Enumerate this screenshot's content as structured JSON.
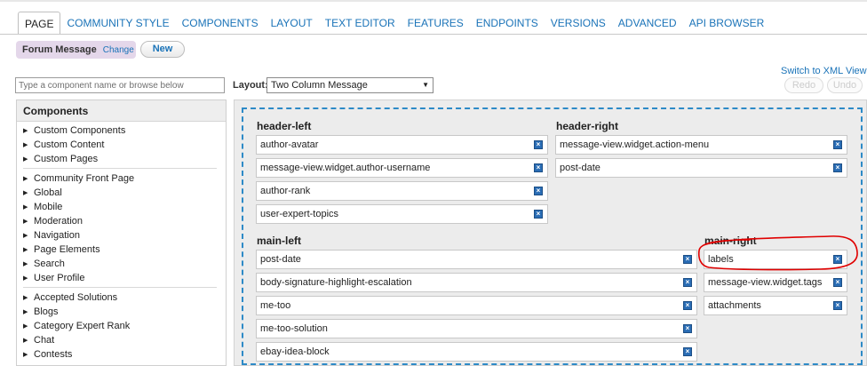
{
  "tabs": [
    "PAGE",
    "COMMUNITY STYLE",
    "COMPONENTS",
    "LAYOUT",
    "TEXT EDITOR",
    "FEATURES",
    "ENDPOINTS",
    "VERSIONS",
    "ADVANCED",
    "API BROWSER"
  ],
  "template": {
    "name": "Forum Message",
    "change_label": "Change"
  },
  "new_button": "New",
  "xml_link": "Switch to XML View",
  "search": {
    "placeholder": "Type a component name or browse below",
    "value": ""
  },
  "layout": {
    "label": "Layout:",
    "selected": "Two Column Message"
  },
  "history": {
    "redo": "Redo",
    "undo": "Undo"
  },
  "components": {
    "title": "Components",
    "group1": [
      "Custom Components",
      "Custom Content",
      "Custom Pages"
    ],
    "group2": [
      "Community Front Page",
      "Global",
      "Mobile",
      "Moderation",
      "Navigation",
      "Page Elements",
      "Search",
      "User Profile"
    ],
    "group3": [
      "Accepted Solutions",
      "Blogs",
      "Category Expert Rank",
      "Chat",
      "Contests"
    ]
  },
  "regions": {
    "header_left": {
      "title": "header-left",
      "items": [
        "author-avatar",
        "message-view.widget.author-username",
        "author-rank",
        "user-expert-topics"
      ]
    },
    "header_right": {
      "title": "header-right",
      "items": [
        "message-view.widget.action-menu",
        "post-date"
      ]
    },
    "main_left": {
      "title": "main-left",
      "items": [
        "post-date",
        "body-signature-highlight-escalation",
        "me-too",
        "me-too-solution",
        "ebay-idea-block"
      ]
    },
    "main_right": {
      "title": "main-right",
      "items": [
        "labels",
        "message-view.widget.tags",
        "attachments"
      ]
    }
  },
  "remove_icon": "remove-x-icon",
  "colors": {
    "link": "#1a73b8",
    "template_chip": "#e4d7ea",
    "dashed_border": "#2d8ac7",
    "remove_icon": "#2a6db5",
    "annotation": "#e00000"
  }
}
